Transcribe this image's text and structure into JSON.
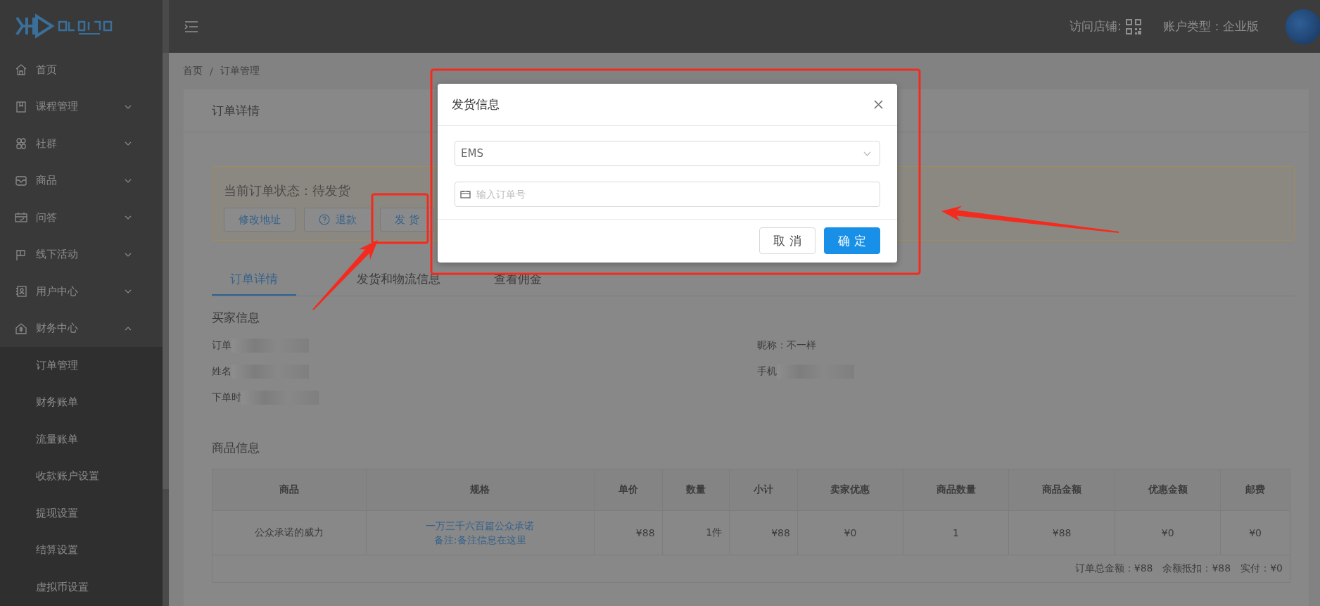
{
  "sidebar": {
    "items": [
      {
        "label": "首页"
      },
      {
        "label": "课程管理",
        "expanded": false
      },
      {
        "label": "社群",
        "expanded": false
      },
      {
        "label": "商品",
        "expanded": false
      },
      {
        "label": "问答",
        "expanded": false
      },
      {
        "label": "线下活动",
        "expanded": false
      },
      {
        "label": "用户中心",
        "expanded": false
      },
      {
        "label": "财务中心",
        "expanded": true,
        "children": [
          {
            "label": "订单管理"
          },
          {
            "label": "财务账单"
          },
          {
            "label": "流量账单"
          },
          {
            "label": "收款账户设置"
          },
          {
            "label": "提现设置"
          },
          {
            "label": "结算设置"
          },
          {
            "label": "虚拟币设置"
          }
        ]
      }
    ]
  },
  "header": {
    "shop_label": "访问店铺:",
    "account": "账户类型：企业版"
  },
  "breadcrumb": {
    "items": [
      "首页",
      "订单管理"
    ],
    "separator": "/"
  },
  "card": {
    "title": "订单详情",
    "status": {
      "text": "当前订单状态：待发货",
      "buttons": [
        {
          "label": "修改地址"
        },
        {
          "label": "退款",
          "kind": "help"
        },
        {
          "label": "发 货"
        }
      ]
    },
    "tabs": [
      {
        "label": "订单详情",
        "selected": true
      },
      {
        "label": "发货和物流信息",
        "selected": false
      },
      {
        "label": "查看佣金",
        "selected": false
      }
    ],
    "buyer": {
      "title": "买家信息",
      "left": [
        {
          "label": "订单",
          "redacted": true
        },
        {
          "label": "姓名",
          "redacted": true
        },
        {
          "label": "下单时",
          "redacted": true
        }
      ],
      "right": [
        {
          "label": "昵称：不一样",
          "redacted": false
        },
        {
          "label": "手机",
          "redacted": true
        }
      ]
    },
    "products": {
      "title": "商品信息",
      "columns": [
        "商品",
        "规格",
        "单价",
        "数量",
        "小计",
        "卖家优惠",
        "商品数量",
        "商品金额",
        "优惠金额",
        "邮费"
      ],
      "rows": [
        {
          "cells": [
            "公众承诺的威力",
            [
              "一万三千六百篇公众承诺",
              "备注:备注信息在这里"
            ],
            "¥88",
            "1件",
            "¥88",
            "¥0",
            "1",
            "¥88",
            "¥0",
            "¥0"
          ]
        }
      ],
      "summary": "订单总金额：¥88　余额抵扣：¥88　实付：¥0"
    }
  },
  "modal": {
    "title": "发货信息",
    "select": {
      "value": "EMS"
    },
    "input": {
      "placeholder": "输入订单号"
    },
    "buttons": [
      {
        "label": "取 消",
        "kind": "default"
      },
      {
        "label": "确 定",
        "kind": "primary"
      }
    ]
  }
}
